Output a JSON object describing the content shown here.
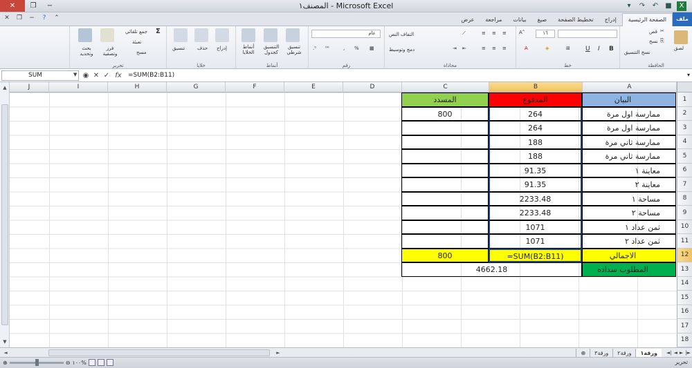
{
  "window": {
    "title": "المصنف١ - Microsoft Excel"
  },
  "ribbon_tabs": [
    "ملف",
    "الصفحة الرئيسية",
    "إدراج",
    "تخطيط الصفحة",
    "صيغ",
    "بيانات",
    "مراجعة",
    "عرض"
  ],
  "ribbon": {
    "clipboard": {
      "label": "الحافظة",
      "paste": "لصق",
      "cut": "قص",
      "copy": "نسخ",
      "format_painter": "نسخ التنسيق"
    },
    "font": {
      "label": "خط",
      "size": "١٦"
    },
    "alignment": {
      "label": "محاذاة",
      "wrap": "التفاف النص",
      "merge": "دمج وتوسيط"
    },
    "number": {
      "label": "رقم",
      "format": "عام"
    },
    "styles": {
      "label": "أنماط",
      "conditional": "تنسيق شرطي",
      "table": "التنسيق كجدول",
      "cell_styles": "أنماط الخلايا"
    },
    "cells": {
      "label": "خلايا",
      "insert": "إدراج",
      "delete": "حذف",
      "format": "تنسيق"
    },
    "editing": {
      "label": "تحرير",
      "autosum": "جمع تلقائي",
      "fill": "تعبئة",
      "clear": "مسح",
      "sort": "فرز وتصفية",
      "find": "بحث وتحديد"
    }
  },
  "formula_bar": {
    "name_box": "SUM",
    "formula": "=SUM(B2:B11)",
    "cancel": "✕",
    "enter": "✓",
    "fx": "fx"
  },
  "columns": [
    "J",
    "I",
    "H",
    "G",
    "F",
    "E",
    "D",
    "C",
    "B",
    "A"
  ],
  "rows": [
    "1",
    "2",
    "3",
    "4",
    "5",
    "6",
    "7",
    "8",
    "9",
    "10",
    "11",
    "12",
    "13",
    "14",
    "15",
    "16",
    "17",
    "18"
  ],
  "sheet": {
    "A": [
      "البيان",
      "ممارسة اول مرة",
      "ممارسة اول مرة",
      "ممارسة ثاني مرة",
      "ممارسة ثاني مرة",
      "معاينة ١",
      "معاينة ٢",
      "مساحة ١",
      "مساحة ٢",
      "ثمن عداد ١",
      "ثمن عداد ٢",
      "الاجمالي",
      "المطلوب سداده"
    ],
    "B": [
      "المدفوع",
      "264",
      "264",
      "188",
      "188",
      "91.35",
      "91.35",
      "2233.48",
      "2233.48",
      "1071",
      "1071",
      "=SUM(B2:B11)"
    ],
    "C": [
      "المسدد",
      "800",
      "",
      "",
      "",
      "",
      "",
      "",
      "",
      "",
      "",
      "800"
    ],
    "BC13": "4662.18"
  },
  "sheet_tabs": [
    "ورقة١",
    "ورقة٢",
    "ورقة٣"
  ],
  "status": {
    "ready": "تحرير",
    "zoom": "١٠٠%"
  },
  "colors": {
    "header_a": "#8db4e2",
    "header_b": "#ff0000",
    "header_c": "#92d050",
    "total_row": "#ffff00",
    "required_row": "#00b050"
  }
}
